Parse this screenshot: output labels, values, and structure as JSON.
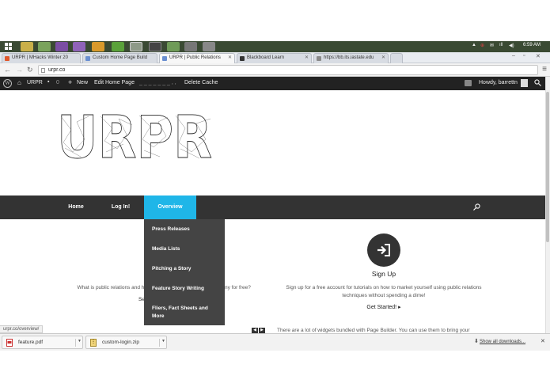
{
  "taskbar": {
    "time": "6:59 AM",
    "tray_glyphs": [
      "▲",
      "⊕",
      "✉",
      "ıll",
      "◀)"
    ]
  },
  "tabs": [
    {
      "title": "URPR | MHacks Winter 20",
      "color": "#e0582b"
    },
    {
      "title": "Custom Home Page Build",
      "color": "#6a8fd1"
    },
    {
      "title": "URPR | Public Relations",
      "color": "#6a8fd1"
    },
    {
      "title": "Blackboard Learn",
      "color": "#333333"
    },
    {
      "title": "https://bb.its.iastate.edu",
      "color": "#8a8a8a"
    }
  ],
  "address_bar": {
    "url": "urpr.co"
  },
  "admin_bar": {
    "site_name": "URPR",
    "comments_count": "0",
    "new_label": "New",
    "edit_label": "Edit Home Page",
    "blurred_item": "_ _ _ _ _ _ _ ,  ,",
    "delete_cache_label": "Delete Cache",
    "howdy_label": "Howdy, barrettn"
  },
  "site": {
    "logo_text": "URPR"
  },
  "nav": {
    "items": [
      "Home",
      "Log In!",
      "Overview"
    ],
    "active": "Overview"
  },
  "dropdown": {
    "items": [
      "Press Releases",
      "Media Lists",
      "Pitching a Story",
      "Feature Story Writing",
      "Fliers, Fact Sheets and More"
    ]
  },
  "content": {
    "left_text_start": "What is public relations and ho",
    "left_text_end": "ny for free?",
    "left_fragment": "Se",
    "signup_title": "Sign Up",
    "signup_text": "Sign up for a free account for tutorials on how to market yourself using public relations techniques without spending a dime!",
    "get_started_label": "Get Started! ▸",
    "bottom_text": "There are a lot of widgets bundled with Page Builder. You can use them to bring your"
  },
  "status_url": "urpr.co/overview/",
  "downloads": {
    "items": [
      "feature.pdf",
      "custom-login.zip"
    ],
    "show_all_label": "Show all downloads..."
  },
  "colors": {
    "nav_bg": "#333333",
    "nav_active": "#1fb6e8",
    "dropdown_bg": "#444444",
    "admin_bar_bg": "#222222"
  }
}
